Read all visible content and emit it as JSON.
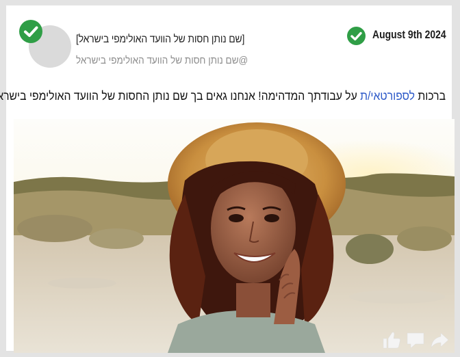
{
  "post": {
    "date": "August 9th 2024",
    "author_name": "[שם נותן חסות של הוועד האולימפי בישראל]",
    "author_handle": "@שם נותן חסות של הוועד האולימפי בישראל",
    "text_before": "ברכות ",
    "text_link": "לספורטאי/ת",
    "text_after": " על עבודתך המדהימה! אנחנו גאים בך שם נותן החסות של הוועד האולימפי בישראל"
  },
  "icons": {
    "avatar_badge": "check-circle-icon",
    "date_badge": "check-circle-icon",
    "like": "thumbs-up-icon",
    "comment": "comment-icon",
    "share": "share-arrow-icon"
  },
  "colors": {
    "verified_green": "#2f9e46",
    "link_blue": "#2a57c7",
    "frame_gray": "#e3e3e3"
  }
}
